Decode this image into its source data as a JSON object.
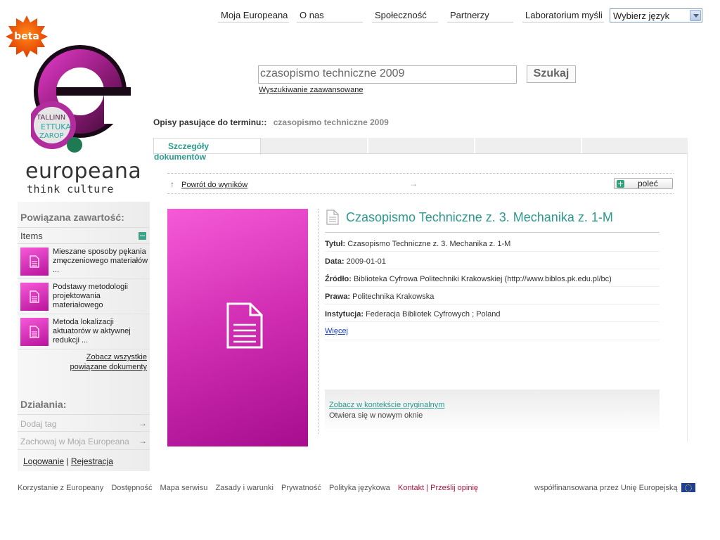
{
  "nav": {
    "items": [
      "Moja Europeana",
      "O nas",
      "Społeczność",
      "Partnerzy",
      "Laboratorium myśli"
    ],
    "language_select": "Wybierz język"
  },
  "logo": {
    "badge": "beta",
    "wordmark": "europeana",
    "tagline": "think culture"
  },
  "search": {
    "value": "czasopismo techniczne 2009",
    "button": "Szukaj",
    "advanced": "Wyszukiwanie zaawansowane"
  },
  "match": {
    "label": "Opisy pasujące do terminu::",
    "term": "czasopismo techniczne 2009"
  },
  "tabs": {
    "active_line1": "Szczegóły",
    "active_line2": "dokumentów"
  },
  "toolbar": {
    "back": "Powrót do wyników",
    "recommend": "poleć"
  },
  "record": {
    "title": "Czasopismo Techniczne z. 3. Mechanika z. 1-M",
    "fields": [
      {
        "label": "Tytuł:",
        "value": "Czasopismo Techniczne z. 3. Mechanika z. 1-M"
      },
      {
        "label": "Data:",
        "value": "2009-01-01"
      },
      {
        "label": "Źródło:",
        "value": "Biblioteka Cyfrowa Politechniki Krakowskiej (http://www.biblos.pk.edu.pl/bc)"
      },
      {
        "label": "Prawa:",
        "value": "Politechnika Krakowska"
      },
      {
        "label": "Instytucja:",
        "value": "Federacja Bibliotek Cyfrowych ;  Poland"
      }
    ],
    "more": "Więcej",
    "context_link": "Zobacz w kontekście oryginalnym",
    "context_note": "Otwiera się w nowym oknie"
  },
  "sidebar": {
    "related_heading": "Powiązana zawartość:",
    "items_label": "Items",
    "related_items": [
      "Mieszane sposoby pękania zmęczeniowego materiałów ...",
      "Podstawy metodologii projektowania materiałowego",
      "Metoda lokalizacji aktuatorów w aktywnej redukcji ..."
    ],
    "see_all": "Zobacz wszystkie powiązane dokumenty",
    "actions_heading": "Działania:",
    "actions": [
      "Dodaj tag",
      "Zachowaj w Moja Europeana"
    ],
    "login": "Logowanie",
    "separator": "|",
    "register": "Rejestracja"
  },
  "footer": {
    "links": [
      "Korzystanie z Europeany",
      "Dostępność",
      "Mapa serwisu",
      "Zasady i warunki",
      "Prywatność",
      "Polityka językowa"
    ],
    "contact": "Kontakt",
    "separator": "|",
    "feedback": "Prześlij opinię",
    "cofunded": "współfinansowana przez Unię Europejską"
  },
  "colors": {
    "accent": "#2a9a8e",
    "magenta": "#d02db2",
    "footer_accent": "#b1143b"
  }
}
